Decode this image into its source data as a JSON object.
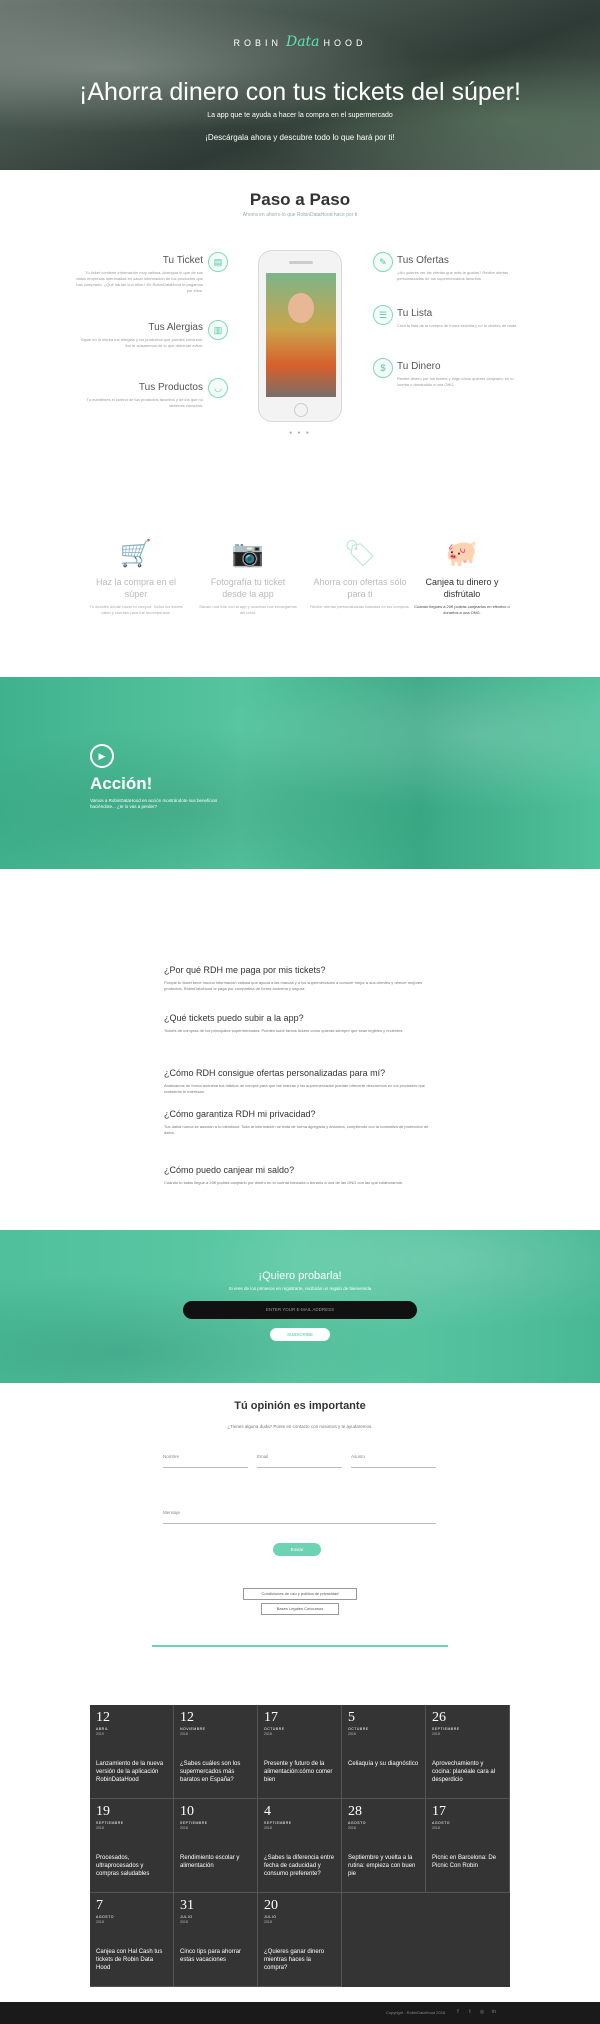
{
  "hero": {
    "logo_left": "ROBIN",
    "logo_mid": "Data",
    "logo_right": "HOOD",
    "title": "¡Ahorra dinero con tus tickets del súper!",
    "subtitle": "La app que te ayuda a hacer la compra en el supermercado",
    "cta": "¡Descárgala ahora y descubre todo lo que hará por ti!"
  },
  "paso": {
    "title": "Paso a Paso",
    "subtitle": "Ahorra en ahorro lo que RobinDataHood hace por ti",
    "left": [
      {
        "title": "Tu Ticket",
        "icon": "receipt-icon",
        "desc": "Tu ticket contiene información muy valiosa. Averigua lo que de sus datos empresas interesadas en sacar información de los productos que has comprado. ¿Qué harían con ellos? En RobinDataHood te pagamos por ellos."
      },
      {
        "title": "Tus Alergias",
        "icon": "chart-icon",
        "desc": "Sigue en la hierba tus alergias y los productos que puedes consumir. Así te avisaremos de lo que deberías evitar."
      },
      {
        "title": "Tus Productos",
        "icon": "basket-icon",
        "desc": "Tú mantienes el control de tus productos favoritos y de los que no deberías consumir."
      }
    ],
    "right": [
      {
        "title": "Tus Ofertas",
        "icon": "tag-icon",
        "desc": "¿No quieres ver las ofertas que más te gustan? Recibe ofertas personalizadas de tus supermercados favoritos."
      },
      {
        "title": "Tu Lista",
        "icon": "list-icon",
        "desc": "Crea tu lista de la compra de forma sencilla y no te olvides de nada."
      },
      {
        "title": "Tu Dinero",
        "icon": "money-icon",
        "desc": "Recibe dinero por tus tickets y elige cómo quieres canjearlo: en tu cuenta o donándolo a una ONG."
      }
    ],
    "dots": "● ● ●"
  },
  "steps": [
    {
      "icon": "cart-icon",
      "title": "Haz la compra en el súper",
      "desc": "Tú decides dónde hacer tu compra. Todos los tickets valen y cuentan para tus recompensas."
    },
    {
      "icon": "camera-icon",
      "title": "Fotografía tu ticket desde la app",
      "desc": "Sácale una foto con la app y nosotros nos encargamos del resto."
    },
    {
      "icon": "tag-icon",
      "title": "Ahorra con ofertas sólo para ti",
      "desc": "Recibe ofertas personalizadas basadas en tus compras."
    },
    {
      "icon": "piggy-bank-icon",
      "title": "Canjea tu dinero y disfrútalo",
      "desc": "Cuando llegues a 20€ podrás canjearlos en efectivo o donarlos a una ONG."
    }
  ],
  "accion": {
    "title": "Acción!",
    "subtitle": "Vamos a RobinDataHood en acción mostrándote sus beneficios haciéndote... ¿te lo vas a perder?"
  },
  "faq": [
    {
      "q": "¿Por qué RDH me paga por mis tickets?",
      "a": "Porque tu ticket tiene mucha información valiosa que ayuda a las marcas y a los supermercados a conocer mejor a sus clientes y ofrecer mejores productos. RobinDataHood te paga por compartirla de forma anónima y segura."
    },
    {
      "q": "¿Qué tickets puedo subir a la app?",
      "a": "Tickets de compras de los principales supermercados. Puedes subir tantos tickets como quieras siempre que sean legibles y recientes."
    },
    {
      "q": "¿Cómo RDH consigue ofertas personalizadas para mí?",
      "a": "Analizamos de forma anónima tus hábitos de compra para que las marcas y los supermercados puedan ofrecerte descuentos en los productos que realmente te interesan."
    },
    {
      "q": "¿Cómo garantiza RDH mi privacidad?",
      "a": "Tus datos nunca se asocian a tu identidad. Toda la información se trata de forma agregada y anónima, cumpliendo con la normativa de protección de datos."
    },
    {
      "q": "¿Cómo puedo canjear mi saldo?",
      "a": "Cuando tu saldo llegue a 20€ podrás canjearlo por dinero en tu cuenta bancaria o donarlo a una de las ONG con las que colaboramos."
    }
  ],
  "quiero": {
    "title": "¡Quiero probarla!",
    "subtitle": "Si eres de los primeros en registrarte, recibirás un regalo de bienvenida",
    "email_placeholder": "ENTER YOUR E-MAIL ADDRESS",
    "button": "SUBSCRIBE"
  },
  "opinion": {
    "title": "Tú opinión es importante",
    "subtitle": "¿Tienes alguna duda? Ponte en contacto con nosotros y te ayudaremos.",
    "name_label": "Nombre",
    "email_label": "Email",
    "subject_label": "Asunto",
    "message_label": "Mensaje",
    "send": "Enviar",
    "legal1": "Condiciones de uso y política de privacidad",
    "legal2": "Bases Legales Concursos"
  },
  "posts": [
    {
      "day": "12",
      "month": "ABRIL",
      "year": "2019",
      "title": "Lanzamiento de la nueva versión de la aplicación RobinDataHood"
    },
    {
      "day": "12",
      "month": "NOVIEMBRE",
      "year": "2018",
      "title": "¿Sabes cuáles son los supermercados más baratos en España?"
    },
    {
      "day": "17",
      "month": "OCTUBRE",
      "year": "2018",
      "title": "Presente y futuro de la alimentación:cómo comer bien"
    },
    {
      "day": "5",
      "month": "OCTUBRE",
      "year": "2018",
      "title": "Celiaquía y su diagnóstico"
    },
    {
      "day": "26",
      "month": "SEPTIEMBRE",
      "year": "2018",
      "title": "Aprovechamiento y cocina: planéale cara al desperdicio"
    },
    {
      "day": "19",
      "month": "SEPTIEMBRE",
      "year": "2018",
      "title": "Procesados, ultraprocesados y compras saludables"
    },
    {
      "day": "10",
      "month": "SEPTIEMBRE",
      "year": "2018",
      "title": "Rendimiento escolar y alimentación"
    },
    {
      "day": "4",
      "month": "SEPTIEMBRE",
      "year": "2018",
      "title": "¿Sabes la diferencia entre fecha de caducidad y consumo preferente?"
    },
    {
      "day": "28",
      "month": "AGOSTO",
      "year": "2018",
      "title": "Septiembre y vuelta a la rutina: empieza con buen pie"
    },
    {
      "day": "17",
      "month": "AGOSTO",
      "year": "2018",
      "title": "Picnic en Barcelona: De Picnic Con Robin"
    },
    {
      "day": "7",
      "month": "AGOSTO",
      "year": "2018",
      "title": "Canjea con Hal Cash tus tickets de Robin Data Hood"
    },
    {
      "day": "31",
      "month": "JULIO",
      "year": "2018",
      "title": "Cinco tips para ahorrar estas vacaciones"
    },
    {
      "day": "20",
      "month": "JULIO",
      "year": "2018",
      "title": "¿Quieres ganar dinero mientras haces la compra?"
    }
  ],
  "footer": {
    "copyright": "Copyright - RobinDataHood 2018",
    "social": [
      "facebook-icon",
      "twitter-icon",
      "instagram-icon",
      "linkedin-icon"
    ]
  },
  "colors": {
    "accent": "#4cc8a0",
    "dark": "#343434"
  }
}
